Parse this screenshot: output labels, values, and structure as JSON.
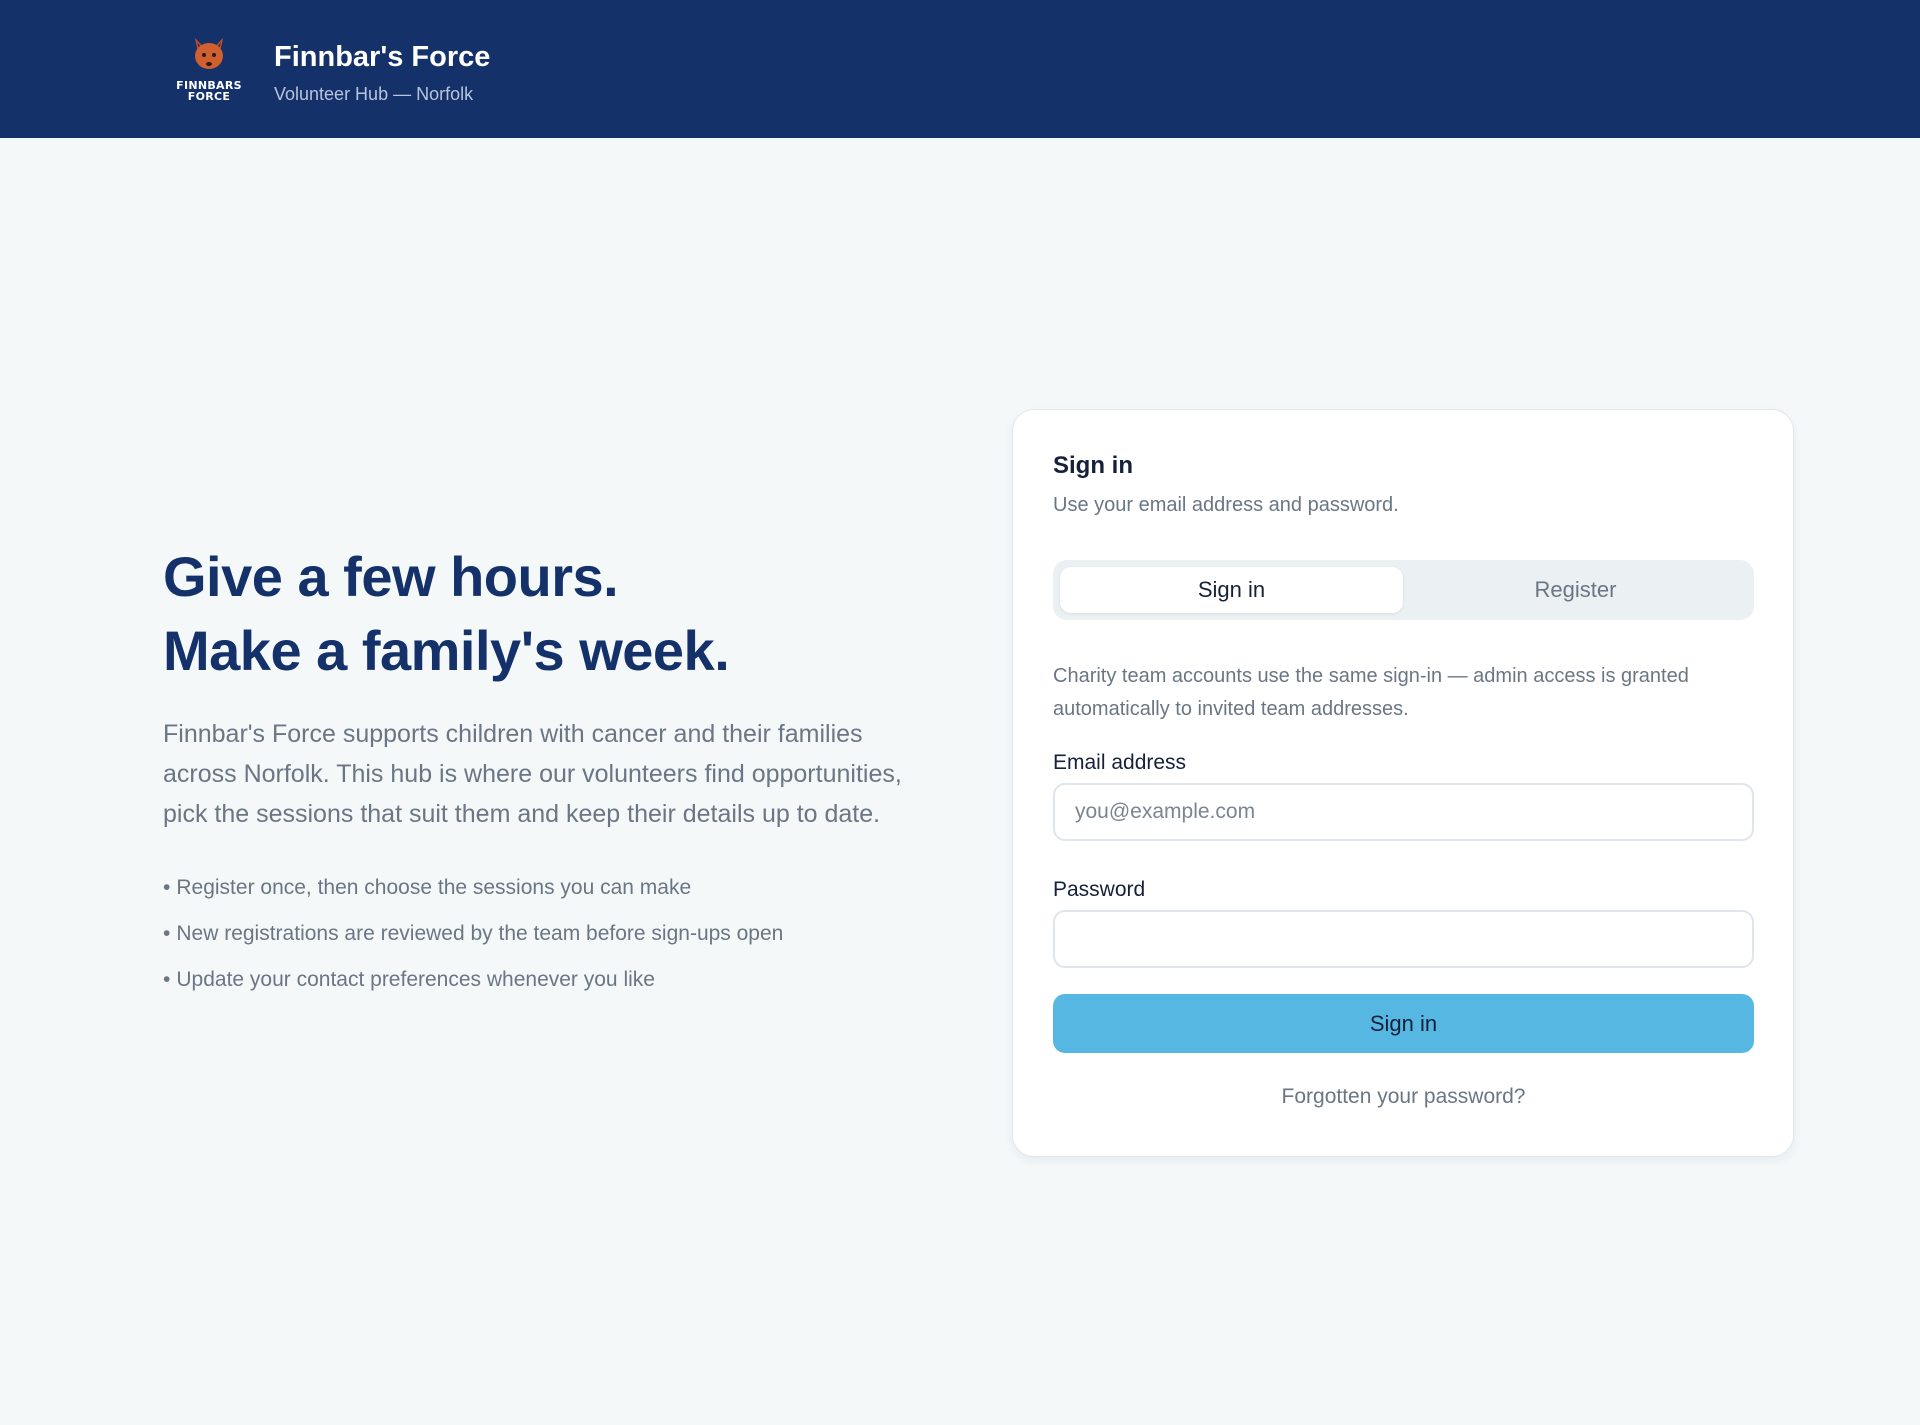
{
  "header": {
    "logo_text_line1": "FINNBARS",
    "logo_text_line2": "FORCE",
    "brand_name": "Finnbar's Force",
    "brand_subtitle": "Volunteer Hub — Norfolk",
    "background_color": "#14316a"
  },
  "hero": {
    "title_line1": "Give a few hours.",
    "title_line2": "Make a family's week.",
    "description": "Finnbar's Force supports children with cancer and their families across Norfolk. This hub is where our volunteers find opportunities, pick the sessions that suit them and keep their details up to date.",
    "bullets": [
      "Register once, then choose the sessions you can make",
      "New registrations are reviewed by the team before sign-ups open",
      "Update your contact preferences whenever you like"
    ]
  },
  "signin_card": {
    "title": "Sign in",
    "subtitle": "Use your email address and password.",
    "tabs": [
      {
        "label": "Sign in",
        "active": true
      },
      {
        "label": "Register",
        "active": false
      }
    ],
    "note": "Charity team accounts use the same sign-in — admin access is granted automatically to invited team addresses.",
    "email_label": "Email address",
    "email_value": "",
    "email_placeholder": "you@example.com",
    "password_label": "Password",
    "password_value": "",
    "submit_label": "Sign in",
    "forgot_link": "Forgotten your password?",
    "accent_color": "#55b7e2"
  }
}
